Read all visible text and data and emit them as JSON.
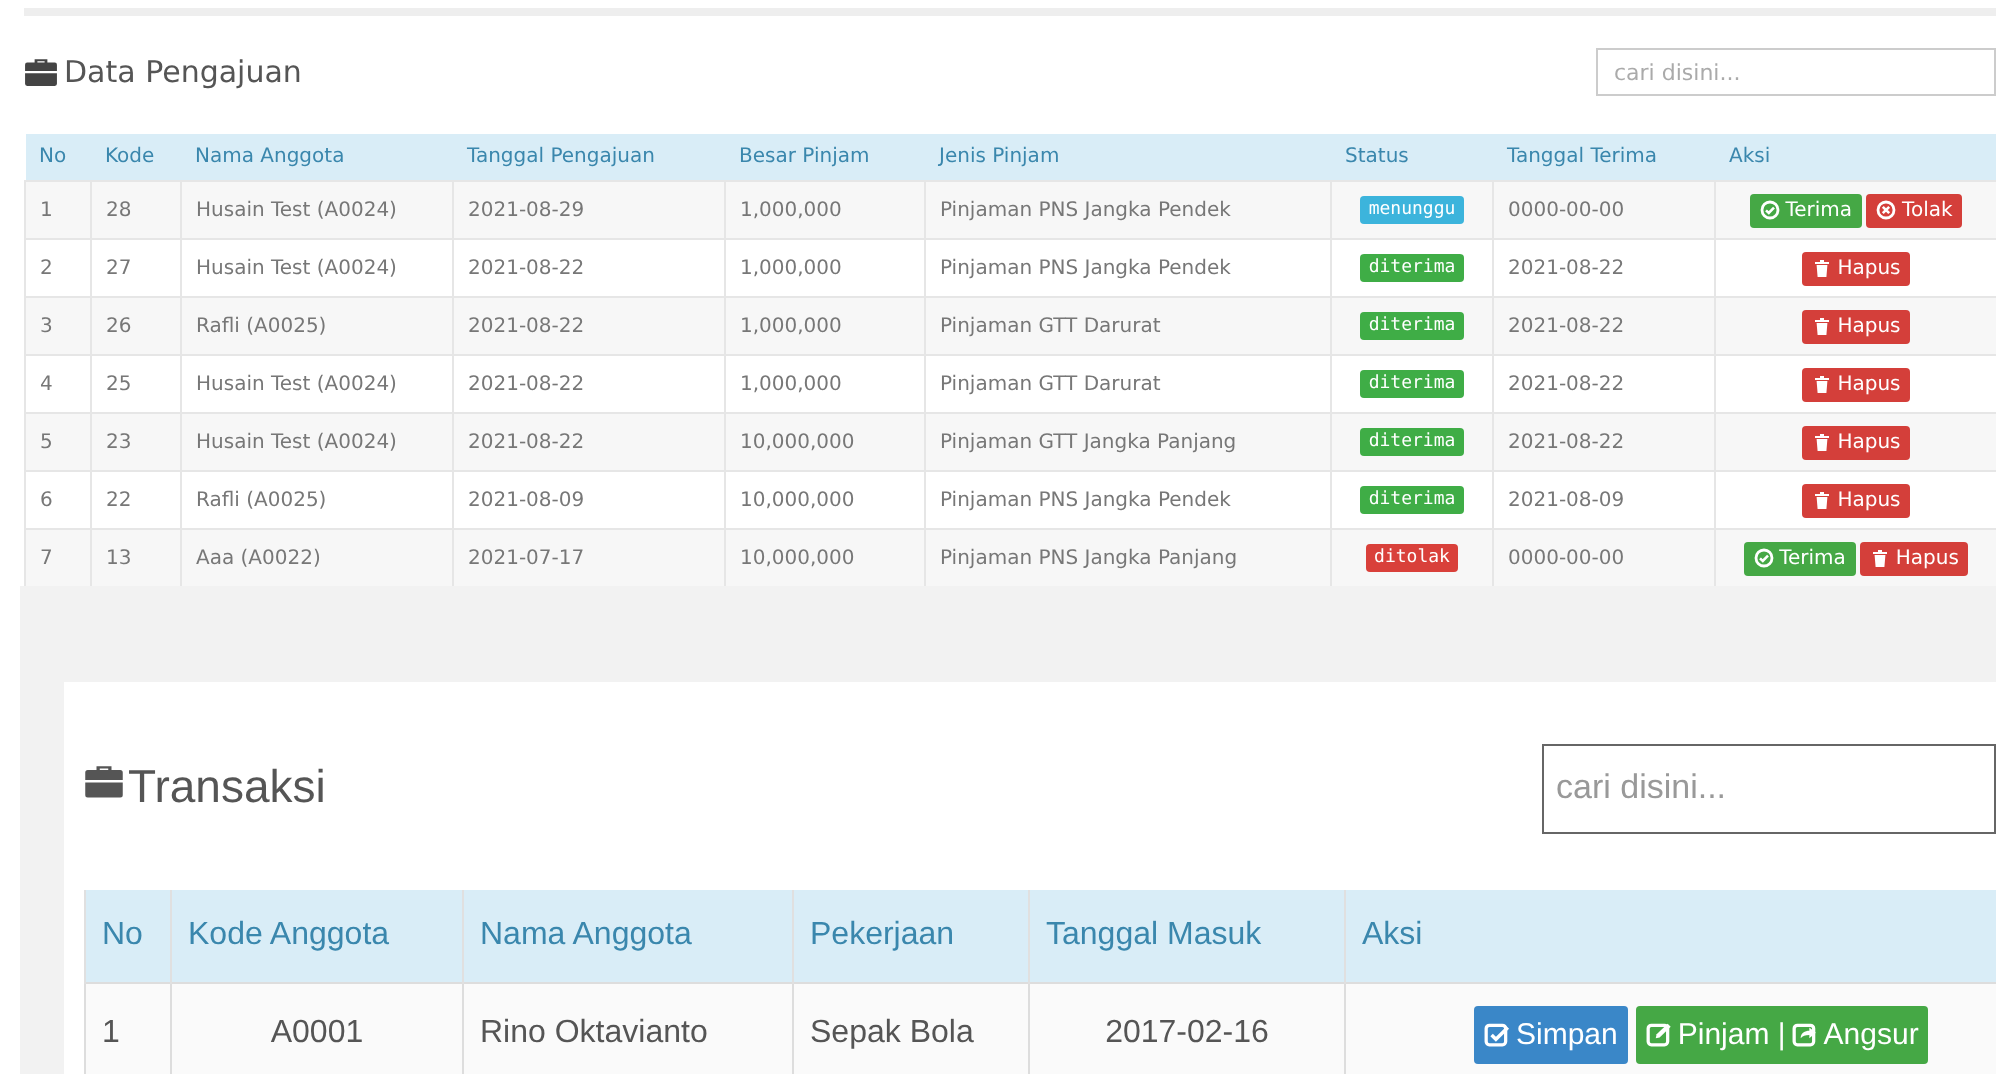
{
  "pengajuan": {
    "title": "Data Pengajuan",
    "search": {
      "placeholder": "cari disini..."
    },
    "columns": [
      "No",
      "Kode",
      "Nama Anggota",
      "Tanggal Pengajuan",
      "Besar Pinjam",
      "Jenis Pinjam",
      "Status",
      "Tanggal Terima",
      "Aksi"
    ],
    "rows": [
      {
        "no": "1",
        "kode": "28",
        "nama": "Husain Test (A0024)",
        "tanggal": "2021-08-29",
        "besar": "1,000,000",
        "jenis": "Pinjaman PNS Jangka Pendek",
        "status": {
          "kind": "waiting",
          "label": "menunggu"
        },
        "terima": "0000-00-00",
        "actions": [
          {
            "kind": "accept",
            "label": "Terima"
          },
          {
            "kind": "reject",
            "label": "Tolak"
          }
        ]
      },
      {
        "no": "2",
        "kode": "27",
        "nama": "Husain Test (A0024)",
        "tanggal": "2021-08-22",
        "besar": "1,000,000",
        "jenis": "Pinjaman PNS Jangka Pendek",
        "status": {
          "kind": "accepted",
          "label": "diterima"
        },
        "terima": "2021-08-22",
        "actions": [
          {
            "kind": "delete",
            "label": "Hapus"
          }
        ]
      },
      {
        "no": "3",
        "kode": "26",
        "nama": "Rafli (A0025)",
        "tanggal": "2021-08-22",
        "besar": "1,000,000",
        "jenis": "Pinjaman GTT Darurat",
        "status": {
          "kind": "accepted",
          "label": "diterima"
        },
        "terima": "2021-08-22",
        "actions": [
          {
            "kind": "delete",
            "label": "Hapus"
          }
        ]
      },
      {
        "no": "4",
        "kode": "25",
        "nama": "Husain Test (A0024)",
        "tanggal": "2021-08-22",
        "besar": "1,000,000",
        "jenis": "Pinjaman GTT Darurat",
        "status": {
          "kind": "accepted",
          "label": "diterima"
        },
        "terima": "2021-08-22",
        "actions": [
          {
            "kind": "delete",
            "label": "Hapus"
          }
        ]
      },
      {
        "no": "5",
        "kode": "23",
        "nama": "Husain Test (A0024)",
        "tanggal": "2021-08-22",
        "besar": "10,000,000",
        "jenis": "Pinjaman GTT Jangka Panjang",
        "status": {
          "kind": "accepted",
          "label": "diterima"
        },
        "terima": "2021-08-22",
        "actions": [
          {
            "kind": "delete",
            "label": "Hapus"
          }
        ]
      },
      {
        "no": "6",
        "kode": "22",
        "nama": "Rafli (A0025)",
        "tanggal": "2021-08-09",
        "besar": "10,000,000",
        "jenis": "Pinjaman PNS Jangka Pendek",
        "status": {
          "kind": "accepted",
          "label": "diterima"
        },
        "terima": "2021-08-09",
        "actions": [
          {
            "kind": "delete",
            "label": "Hapus"
          }
        ]
      },
      {
        "no": "7",
        "kode": "13",
        "nama": "Aaa (A0022)",
        "tanggal": "2021-07-17",
        "besar": "10,000,000",
        "jenis": "Pinjaman PNS Jangka Panjang",
        "status": {
          "kind": "rejected",
          "label": "ditolak"
        },
        "terima": "0000-00-00",
        "actions": [
          {
            "kind": "accept",
            "label": "Terima"
          },
          {
            "kind": "delete",
            "label": "Hapus"
          }
        ]
      }
    ]
  },
  "transaksi": {
    "title": "Transaksi",
    "search": {
      "placeholder": "cari disini..."
    },
    "columns": [
      "No",
      "Kode Anggota",
      "Nama Anggota",
      "Pekerjaan",
      "Tanggal Masuk",
      "Aksi"
    ],
    "rows": [
      {
        "no": "1",
        "kode": "A0001",
        "nama": "Rino Oktavianto",
        "pekerjaan": "Sepak Bola",
        "tanggal": "2017-02-16",
        "actions": [
          {
            "kind": "save",
            "parts": [
              "Simpan"
            ]
          },
          {
            "kind": "loan",
            "parts": [
              "Pinjam |",
              "Angsur"
            ]
          }
        ]
      }
    ]
  }
}
